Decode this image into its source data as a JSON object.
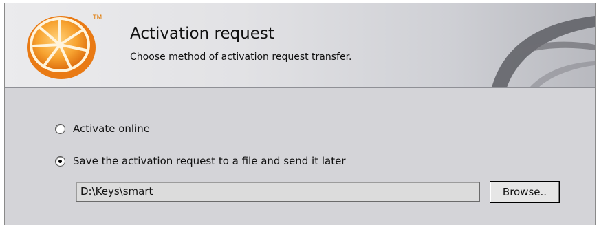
{
  "header": {
    "title": "Activation request",
    "subtitle": "Choose method of activation request transfer.",
    "trademark": "TM",
    "logo_icon": "orange-slice-icon",
    "colors": {
      "logo_orange": "#f08a1c",
      "header_background": "#e4e4e7",
      "panel_background": "#d4d4d8"
    }
  },
  "options": {
    "online_label": "Activate online",
    "online_selected": false,
    "file_label": "Save the activation request to a file and send it later",
    "file_selected": true
  },
  "file_path": {
    "value": "D:\\Keys\\smart"
  },
  "browse_button": {
    "label": "Browse.."
  }
}
